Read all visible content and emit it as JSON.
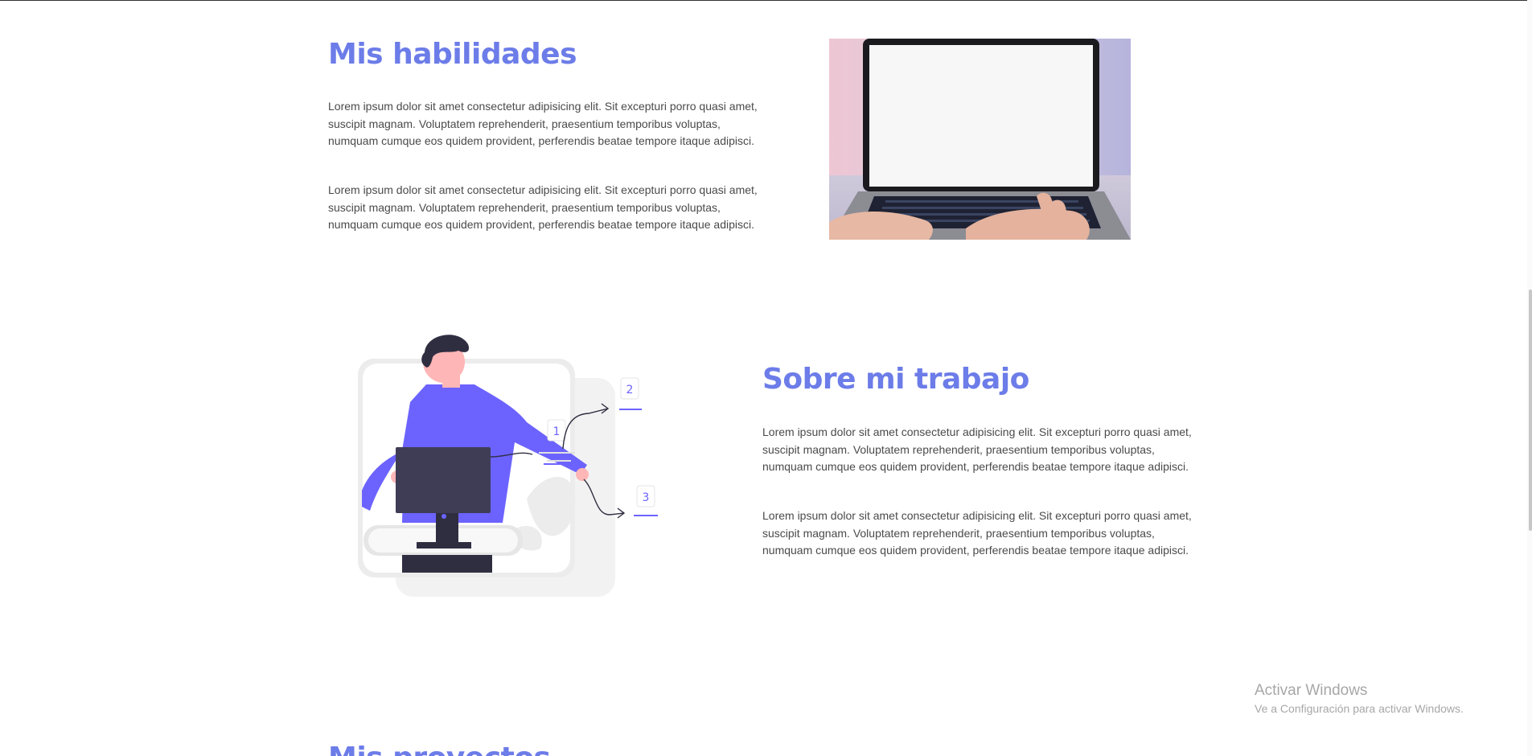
{
  "skills": {
    "title": "Mis habilidades",
    "paragraphs": [
      "Lorem ipsum dolor sit amet consectetur adipisicing elit. Sit excepturi porro quasi amet, suscipit magnam. Voluptatem reprehenderit, praesentium temporibus voluptas, numquam cumque eos quidem provident, perferendis beatae tempore itaque adipisci.",
      "Lorem ipsum dolor sit amet consectetur adipisicing elit. Sit excepturi porro quasi amet, suscipit magnam. Voluptatem reprehenderit, praesentium temporibus voluptas, numquam cumque eos quidem provident, perferendis beatae tempore itaque adipisci."
    ]
  },
  "work": {
    "title": "Sobre mi trabajo",
    "paragraphs": [
      "Lorem ipsum dolor sit amet consectetur adipisicing elit. Sit excepturi porro quasi amet, suscipit magnam. Voluptatem reprehenderit, praesentium temporibus voluptas, numquam cumque eos quidem provident, perferendis beatae tempore itaque adipisci.",
      "Lorem ipsum dolor sit amet consectetur adipisicing elit. Sit excepturi porro quasi amet, suscipit magnam. Voluptatem reprehenderit, praesentium temporibus voluptas, numquam cumque eos quidem provident, perferendis beatae tempore itaque adipisci."
    ],
    "illustration_steps": [
      "1",
      "2",
      "3"
    ]
  },
  "next_section": {
    "title": "Mis proyectos"
  },
  "watermark": {
    "title": "Activar Windows",
    "subtitle": "Ve a Configuración para activar Windows."
  },
  "colors": {
    "accent": "#6c7ce8",
    "illustration_purple": "#6c63ff",
    "text": "#4a4a4a",
    "watermark": "#a7a7a7"
  }
}
